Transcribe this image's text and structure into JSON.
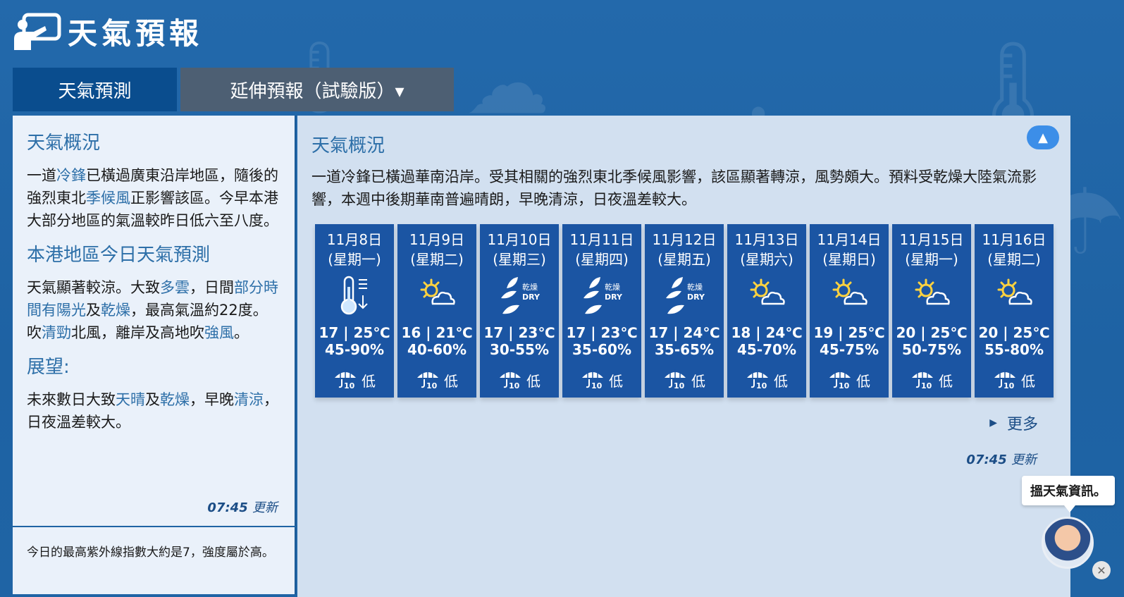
{
  "header": {
    "title": "天氣預報",
    "logo_icon": "presenter-board-icon"
  },
  "tabs": [
    {
      "label": "天氣預測"
    },
    {
      "label": "延伸預報（試驗版）▾"
    }
  ],
  "left": {
    "h1": "天氣概況",
    "p1_a": "一道",
    "p1_k1": "冷鋒",
    "p1_b": "已橫過廣東沿岸地區，隨後的強烈東北",
    "p1_k2": "季候風",
    "p1_c": "正影響該區。今早本港大部分地區的氣溫較昨日低六至八度。",
    "h2": "本港地區今日天氣預測",
    "p2_a": "天氣顯著較涼。大致",
    "p2_k1": "多雲",
    "p2_b": "，日間",
    "p2_k2": "部分時間有陽光",
    "p2_c": "及",
    "p2_k3": "乾燥",
    "p2_d": "，最高氣溫約22度。吹",
    "p2_k4": "清勁",
    "p2_e": "北風，離岸及高地吹",
    "p2_k5": "強風",
    "p2_f": "。",
    "h3": "展望:",
    "p3_a": "未來數日大致",
    "p3_k1": "天晴",
    "p3_b": "及",
    "p3_k2": "乾燥",
    "p3_c": "，早晚",
    "p3_k3": "清涼",
    "p3_d": "，日夜溫差較大。",
    "update_time": "07:45",
    "update_label": "更新",
    "uv_text": "今日的最高紫外線指數大約是7，強度屬於高。"
  },
  "right": {
    "heading": "天氣概況",
    "collapse_icon": "▲",
    "text": "一道冷鋒已橫過華南沿岸。受其相關的強烈東北季候風影響，該區顯著轉涼，風勢頗大。預料受乾燥大陸氣流影響，本週中後期華南普遍晴朗，早晚清涼，日夜溫差較大。",
    "more_label": "更多",
    "update_time": "07:45",
    "update_label": "更新"
  },
  "forecast": [
    {
      "date": "11月8日",
      "week": "(星期一)",
      "icon": "cold-icon",
      "temp": "17 | 25℃",
      "rh": "45-90%",
      "psr": "低"
    },
    {
      "date": "11月9日",
      "week": "(星期二)",
      "icon": "sunny-periods-icon",
      "temp": "16 | 21℃",
      "rh": "40-60%",
      "psr": "低"
    },
    {
      "date": "11月10日",
      "week": "(星期三)",
      "icon": "dry-icon",
      "temp": "17 | 23℃",
      "rh": "30-55%",
      "psr": "低"
    },
    {
      "date": "11月11日",
      "week": "(星期四)",
      "icon": "dry-icon",
      "temp": "17 | 23℃",
      "rh": "35-60%",
      "psr": "低"
    },
    {
      "date": "11月12日",
      "week": "(星期五)",
      "icon": "dry-icon",
      "temp": "17 | 24℃",
      "rh": "35-65%",
      "psr": "低"
    },
    {
      "date": "11月13日",
      "week": "(星期六)",
      "icon": "sunny-periods-icon",
      "temp": "18 | 24℃",
      "rh": "45-70%",
      "psr": "低"
    },
    {
      "date": "11月14日",
      "week": "(星期日)",
      "icon": "sunny-periods-icon",
      "temp": "19 | 25℃",
      "rh": "45-75%",
      "psr": "低"
    },
    {
      "date": "11月15日",
      "week": "(星期一)",
      "icon": "sunny-periods-icon",
      "temp": "20 | 25℃",
      "rh": "50-75%",
      "psr": "低"
    },
    {
      "date": "11月16日",
      "week": "(星期二)",
      "icon": "sunny-periods-icon",
      "temp": "20 | 25℃",
      "rh": "55-80%",
      "psr": "低"
    }
  ],
  "chatbot": {
    "bubble": "搵天氣資訊。",
    "close": "✕"
  }
}
